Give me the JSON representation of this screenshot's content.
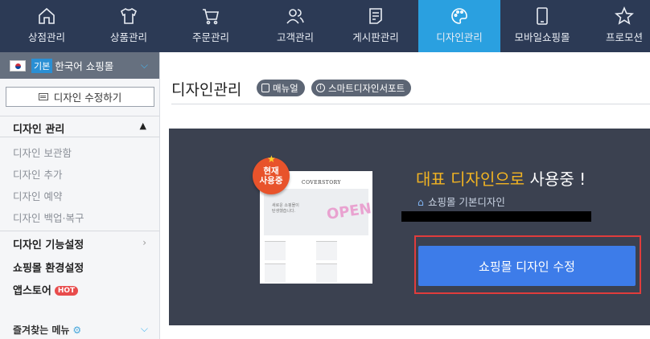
{
  "topnav": {
    "items": [
      {
        "label": "상점관리",
        "icon": "home-icon"
      },
      {
        "label": "상품관리",
        "icon": "shirt-icon"
      },
      {
        "label": "주문관리",
        "icon": "cart-icon"
      },
      {
        "label": "고객관리",
        "icon": "users-icon"
      },
      {
        "label": "게시판관리",
        "icon": "document-icon"
      },
      {
        "label": "디자인관리",
        "icon": "palette-icon",
        "active": true
      },
      {
        "label": "모바일쇼핑몰",
        "icon": "mobile-icon"
      },
      {
        "label": "프로모션",
        "icon": "star-icon"
      }
    ],
    "active_color": "#2aa0e0",
    "bg_color": "#2c3a55"
  },
  "sidebar": {
    "shop_select": {
      "badge": "기본",
      "label": "한국어 쇼핑몰"
    },
    "edit_design_button": "디자인 수정하기",
    "section_title": "디자인 관리",
    "sub_items": [
      "디자인 보관함",
      "디자인 추가",
      "디자인 예약",
      "디자인 백업·복구"
    ],
    "links": [
      {
        "label": "디자인 기능설정"
      },
      {
        "label": "쇼핑몰 환경설정"
      },
      {
        "label": "앱스토어",
        "badge": "HOT"
      }
    ],
    "favorites": "즐겨찾는 메뉴"
  },
  "main": {
    "title": "디자인관리",
    "manual_button": "매뉴얼",
    "support_button": "스마트디자인서포트",
    "current_badge": [
      "현재",
      "사용중"
    ],
    "headline_accent": "대표 디자인으로",
    "headline_rest": " 사용중 !",
    "shop_design_name": "쇼핑몰 기본디자인",
    "edit_cta": "쇼핑몰 디자인 수정",
    "thumbnail": {
      "brand": "COVERSTORY",
      "hero_text": [
        "새로운 쇼핑몰이",
        "탄생했습니다."
      ],
      "hero_art": "OPEN"
    }
  }
}
